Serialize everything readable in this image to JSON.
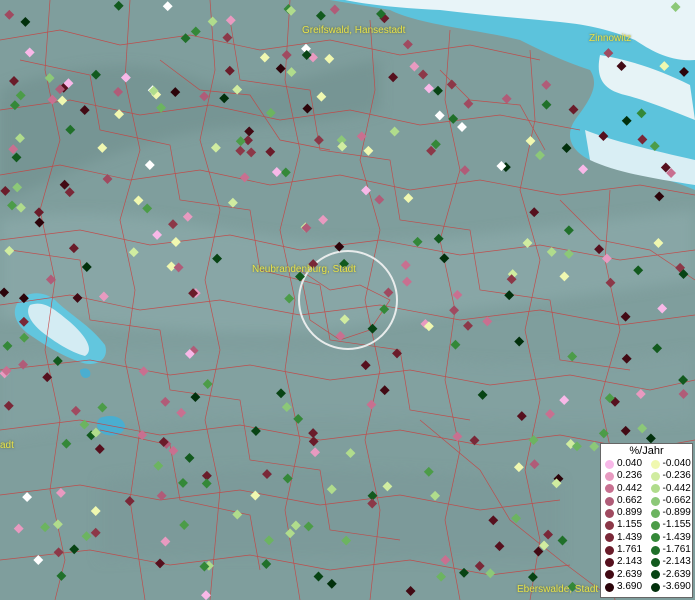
{
  "map": {
    "places": [
      {
        "id": "greifswald",
        "name": "Greifswald, Hansestadt"
      },
      {
        "id": "zinnowitz",
        "name": "Zinnowitz"
      },
      {
        "id": "neubrandenburg",
        "name": "Neubrandenburg, Stadt"
      },
      {
        "id": "eberswalde",
        "name": "Eberswalde, Stadt"
      },
      {
        "id": "left-edge",
        "name": "adt"
      }
    ],
    "legend": {
      "title": "%/Jahr",
      "positive": [
        {
          "label": "0.040",
          "color": "#f8b8e8"
        },
        {
          "label": "0.236",
          "color": "#e89ac0"
        },
        {
          "label": "0.442",
          "color": "#c87090"
        },
        {
          "label": "0.662",
          "color": "#b05c78"
        },
        {
          "label": "0.899",
          "color": "#a04a60"
        },
        {
          "label": "1.155",
          "color": "#8c3848"
        },
        {
          "label": "1.439",
          "color": "#7a2838"
        },
        {
          "label": "1.761",
          "color": "#6a1c2a"
        },
        {
          "label": "2.143",
          "color": "#56101e"
        },
        {
          "label": "2.639",
          "color": "#420a14"
        },
        {
          "label": "3.690",
          "color": "#2c040a"
        }
      ],
      "negative": [
        {
          "label": "-0.040",
          "color": "#f0f8b0"
        },
        {
          "label": "-0.236",
          "color": "#d0eca0"
        },
        {
          "label": "-0.442",
          "color": "#b0dc8c"
        },
        {
          "label": "-0.662",
          "color": "#8cc878"
        },
        {
          "label": "-0.899",
          "color": "#6cb460"
        },
        {
          "label": "-1.155",
          "color": "#4c9c48"
        },
        {
          "label": "-1.439",
          "color": "#348838"
        },
        {
          "label": "-1.761",
          "color": "#20702a"
        },
        {
          "label": "-2.143",
          "color": "#125a1e"
        },
        {
          "label": "-2.639",
          "color": "#084414"
        },
        {
          "label": "-3.690",
          "color": "#02300c"
        }
      ],
      "zero_color": "#ffffff"
    }
  }
}
